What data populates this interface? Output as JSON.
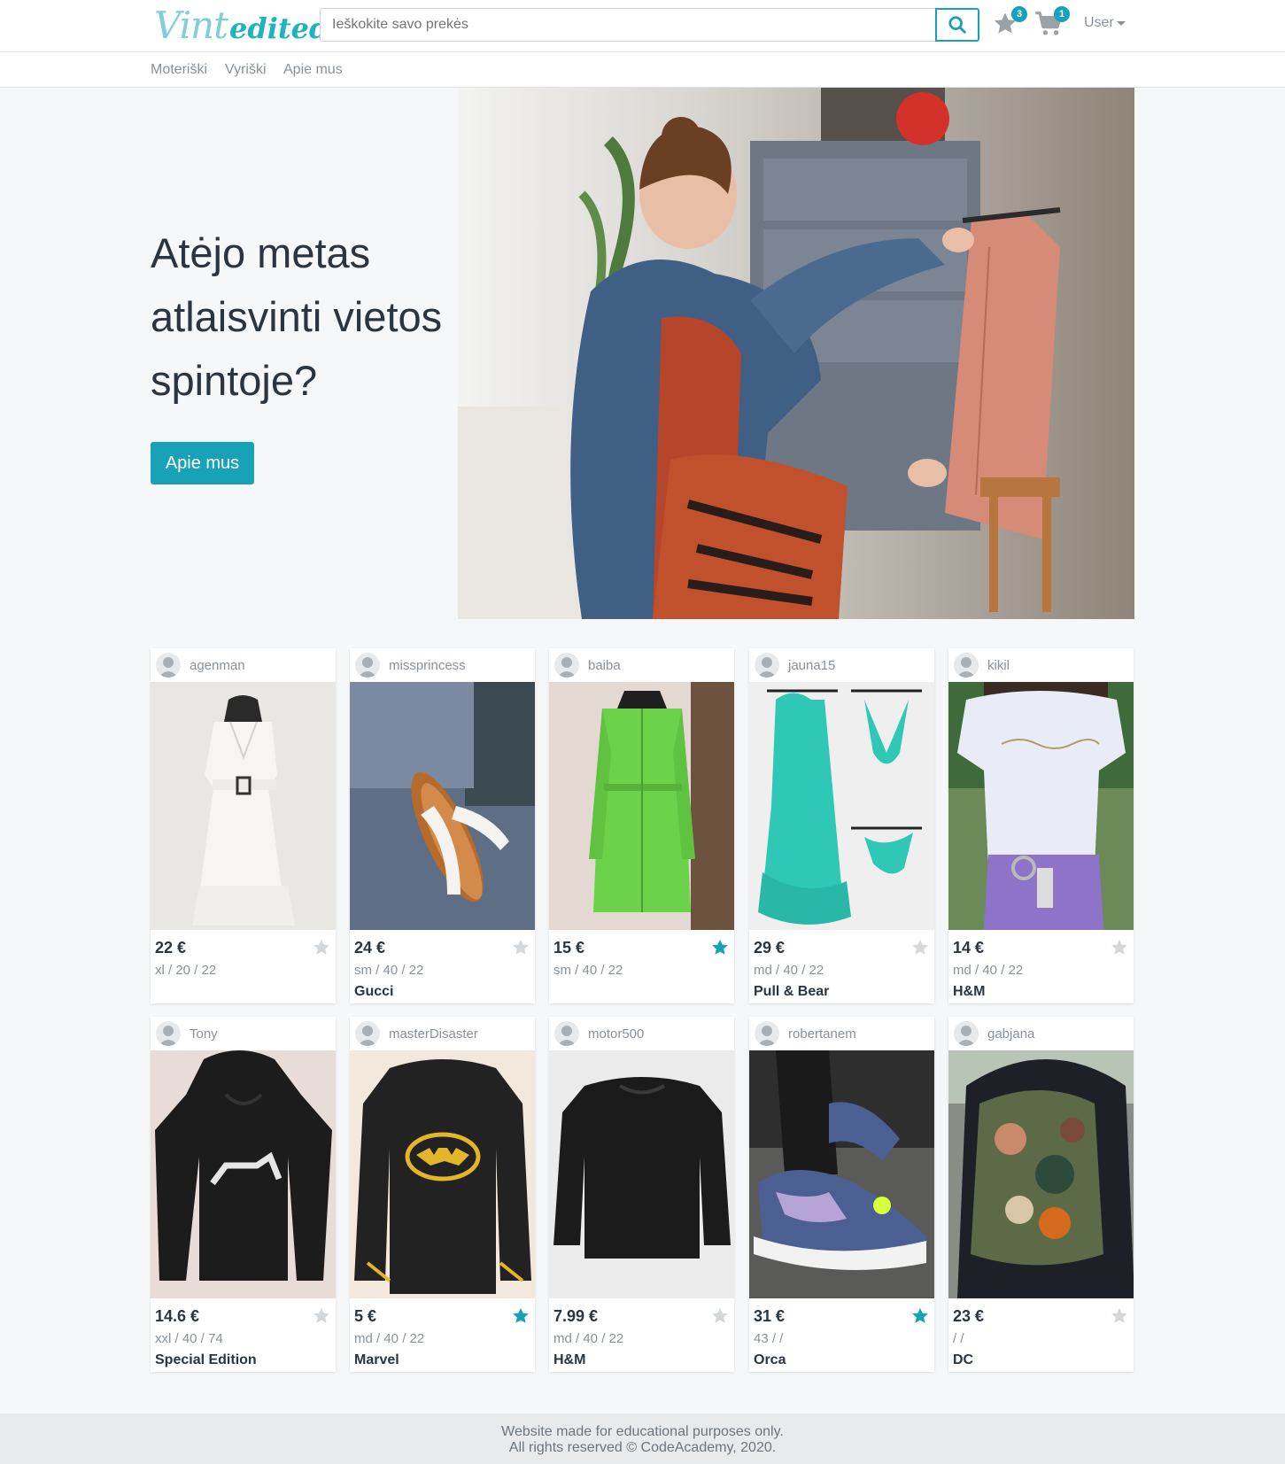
{
  "header": {
    "logo": {
      "part1": "Vint",
      "part2": "edited"
    },
    "search": {
      "placeholder": "Ieškokite savo prekės"
    },
    "favorites_count": "3",
    "cart_count": "1",
    "user_label": "User"
  },
  "nav": {
    "items": [
      {
        "label": "Moteriški"
      },
      {
        "label": "Vyriški"
      },
      {
        "label": "Apie mus"
      }
    ]
  },
  "hero": {
    "title": "Atėjo metas atlaisvinti vietos spintoje?",
    "button": "Apie mus"
  },
  "products": [
    {
      "user": "agenman",
      "price": "22 €",
      "size": "xl / 20 / 22",
      "brand": "",
      "favorite": false,
      "img": "white-dress"
    },
    {
      "user": "missprincess",
      "price": "24 €",
      "size": "sm / 40 / 22",
      "brand": "Gucci",
      "favorite": false,
      "img": "sandals"
    },
    {
      "user": "baiba",
      "price": "15 €",
      "size": "sm / 40 / 22",
      "brand": "",
      "favorite": true,
      "img": "green-dress"
    },
    {
      "user": "jauna15",
      "price": "29 €",
      "size": "md / 40 / 22",
      "brand": "Pull & Bear",
      "favorite": false,
      "img": "teal-dress-bikini"
    },
    {
      "user": "kikil",
      "price": "14 €",
      "size": "md / 40 / 22",
      "brand": "H&M",
      "favorite": false,
      "img": "white-tshirt"
    },
    {
      "user": "Tony",
      "price": "14.6 €",
      "size": "xxl / 40 / 74",
      "brand": "Special Edition",
      "favorite": false,
      "img": "metallica-hoodie"
    },
    {
      "user": "masterDisaster",
      "price": "5 €",
      "size": "md / 40 / 22",
      "brand": "Marvel",
      "favorite": true,
      "img": "batman-sweater"
    },
    {
      "user": "motor500",
      "price": "7.99 €",
      "size": "md / 40 / 22",
      "brand": "H&M",
      "favorite": false,
      "img": "black-sweater"
    },
    {
      "user": "robertanem",
      "price": "31 €",
      "size": "43 / /",
      "brand": "Orca",
      "favorite": true,
      "img": "sneakers"
    },
    {
      "user": "gabjana",
      "price": "23 €",
      "size": "/ /",
      "brand": "DC",
      "favorite": false,
      "img": "camo-backpack"
    }
  ],
  "footer": {
    "line1": "Website made for educational purposes only.",
    "line2": "All rights reserved © CodeAcademy, 2020."
  },
  "colors": {
    "accent": "#17a2b8",
    "star_inactive": "#d5d8db",
    "text_muted": "#8a9299"
  }
}
